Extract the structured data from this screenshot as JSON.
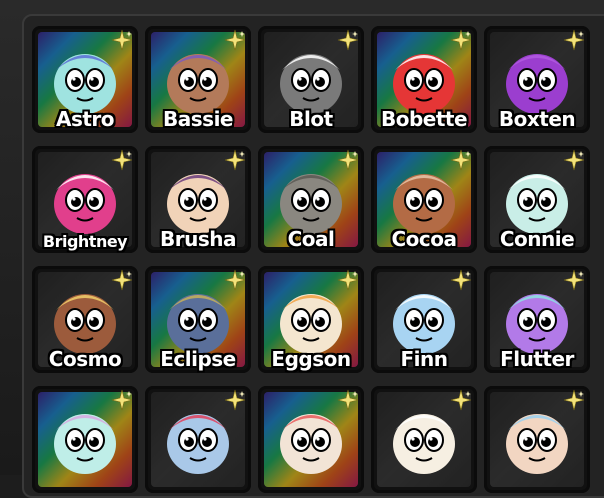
{
  "characters": [
    {
      "name": "Astro",
      "bg": "rainbow",
      "body": "#9fe3e0",
      "accent": "#5a6fd6",
      "icon": "astro-character-icon"
    },
    {
      "name": "Bassie",
      "bg": "rainbow",
      "body": "#b37a5a",
      "accent": "#7b5bbf",
      "icon": "bassie-character-icon"
    },
    {
      "name": "Blot",
      "bg": "dark",
      "body": "#7a7a7a",
      "accent": "#ffffff",
      "icon": "blot-character-icon"
    },
    {
      "name": "Bobette",
      "bg": "rainbow",
      "body": "#e53636",
      "accent": "#ffffff",
      "icon": "bobette-character-icon"
    },
    {
      "name": "Boxten",
      "bg": "dark",
      "body": "#9b3ecf",
      "accent": "#b25be0",
      "icon": "boxten-character-icon"
    },
    {
      "name": "Brightney",
      "bg": "dark",
      "body": "#e13f8c",
      "accent": "#ffffff",
      "icon": "brightney-character-icon"
    },
    {
      "name": "Brusha",
      "bg": "dark",
      "body": "#f1d3b8",
      "accent": "#6a3b7a",
      "icon": "brusha-character-icon"
    },
    {
      "name": "Coal",
      "bg": "rainbow",
      "body": "#8a8780",
      "accent": "#5b5953",
      "icon": "coal-character-icon"
    },
    {
      "name": "Cocoa",
      "bg": "rainbow",
      "body": "#b36b45",
      "accent": "#e8c6a8",
      "icon": "cocoa-character-icon"
    },
    {
      "name": "Connie",
      "bg": "dark",
      "body": "#c9eee7",
      "accent": "#ffffff",
      "icon": "connie-character-icon"
    },
    {
      "name": "Cosmo",
      "bg": "dark",
      "body": "#9c5b3c",
      "accent": "#f2d06b",
      "icon": "cosmo-character-icon"
    },
    {
      "name": "Eclipse",
      "bg": "rainbow",
      "body": "#5a6f9a",
      "accent": "#c7b25a",
      "icon": "eclipse-character-icon"
    },
    {
      "name": "Eggson",
      "bg": "rainbow",
      "body": "#f4e6cf",
      "accent": "#f0a040",
      "icon": "eggson-character-icon"
    },
    {
      "name": "Finn",
      "bg": "dark",
      "body": "#a8d4f2",
      "accent": "#ffffff",
      "icon": "finn-character-icon"
    },
    {
      "name": "Flutter",
      "bg": "dark",
      "body": "#b27ae8",
      "accent": "#8be3e0",
      "icon": "flutter-character-icon"
    },
    {
      "name": "",
      "bg": "rainbow",
      "body": "#bfeee8",
      "accent": "#d7a8e0",
      "icon": "character-icon"
    },
    {
      "name": "",
      "bg": "dark",
      "body": "#a9c8e8",
      "accent": "#e13f5a",
      "icon": "character-icon"
    },
    {
      "name": "",
      "bg": "rainbow",
      "body": "#f2e4d6",
      "accent": "#e85a5a",
      "icon": "character-icon"
    },
    {
      "name": "",
      "bg": "dark",
      "body": "#f6efe2",
      "accent": "#ffffff",
      "icon": "character-icon"
    },
    {
      "name": "",
      "bg": "dark",
      "body": "#f2d6c2",
      "accent": "#9ad0f0",
      "icon": "character-icon"
    }
  ],
  "colors": {
    "panel": "#232323",
    "sparkle": "#f3e27a"
  }
}
